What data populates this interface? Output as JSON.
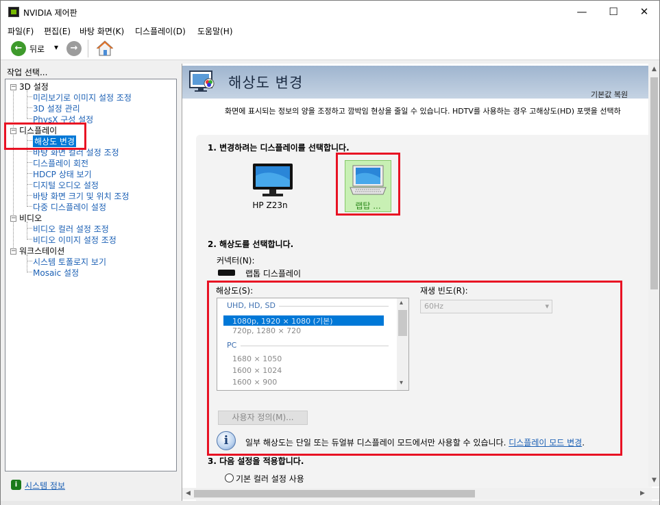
{
  "window": {
    "title": "NVIDIA 제어판",
    "minimize": "—",
    "maximize": "☐",
    "close": "✕"
  },
  "menu": [
    "파일(F)",
    "편집(E)",
    "바탕 화면(K)",
    "디스플레이(D)",
    "도움말(H)"
  ],
  "toolbar": {
    "back_label": "뒤로",
    "dropdown_glyph": "▾",
    "back_glyph": "←",
    "forward_glyph": "→"
  },
  "sidebar": {
    "task_label": "작업 선택...",
    "categories": [
      {
        "label": "3D 설정",
        "items": [
          "미리보기로 이미지 설정 조정",
          "3D 설정 관리",
          "PhysX 구성 설정"
        ]
      },
      {
        "label": "디스플레이",
        "items": [
          "해상도 변경",
          "바탕 화면 컬러 설정 조정",
          "디스플레이 회전",
          "HDCP 상태 보기",
          "디지털 오디오 설정",
          "바탕 화면 크기 및 위치 조정",
          "다중 디스플레이 설정"
        ]
      },
      {
        "label": "비디오",
        "items": [
          "비디오 컬러 설정 조정",
          "비디오 이미지 설정 조정"
        ]
      },
      {
        "label": "워크스테이션",
        "items": [
          "시스템 토폴로지 보기",
          "Mosaic 설정"
        ]
      }
    ],
    "expander_glyph": "−",
    "selected_item": "해상도 변경",
    "system_info": "시스템 정보"
  },
  "page": {
    "title": "해상도 변경",
    "restore_defaults": "기본값 복원",
    "description": "화면에 표시되는 정보의 양을 조정하고 깜박임 현상을 줄일 수 있습니다. HDTV를 사용하는 경우 고해상도(HD) 포맷을 선택하",
    "step1": "1. 변경하려는 디스플레이를 선택합니다.",
    "displays": [
      {
        "name": "HP Z23n",
        "selected": false
      },
      {
        "name": "랩탑 ...",
        "selected": true
      }
    ],
    "step2": "2. 해상도를 선택합니다.",
    "connector_label": "커넥터(N):",
    "connector_value": "랩톱 디스플레이",
    "resolution_label": "해상도(S):",
    "refresh_label": "재생 빈도(R):",
    "resolution_groups": [
      {
        "name": "UHD, HD, SD",
        "items": [
          "1080p, 1920 × 1080 (기본)",
          "720p, 1280 × 720"
        ]
      },
      {
        "name": "PC",
        "items": [
          "1680 × 1050",
          "1600 × 1024",
          "1600 × 900"
        ]
      }
    ],
    "selected_resolution": "1080p, 1920 × 1080 (기본)",
    "refresh_value": "60Hz",
    "custom_button": "사용자 정의(M)...",
    "info_glyph": "i",
    "info_text": "일부 해상도는 단일 또는 듀얼뷰 디스플레이 모드에서만 사용할 수 있습니다. ",
    "info_link": "디스플레이 모드 변경",
    "info_end": ".",
    "step3": "3. 다음 설정을 적용합니다.",
    "radio_default": "기본 컬러 설정 사용"
  },
  "scroll_arrows": {
    "up": "▲",
    "down": "▼",
    "left": "◀",
    "right": "▶",
    "listbox_up": "▴",
    "listbox_down": "▾"
  },
  "colors": {
    "nvidia_green": "#76b900",
    "selection_blue": "#0078d7",
    "highlight_red": "#e81123",
    "link_blue": "#1a5fb4"
  }
}
